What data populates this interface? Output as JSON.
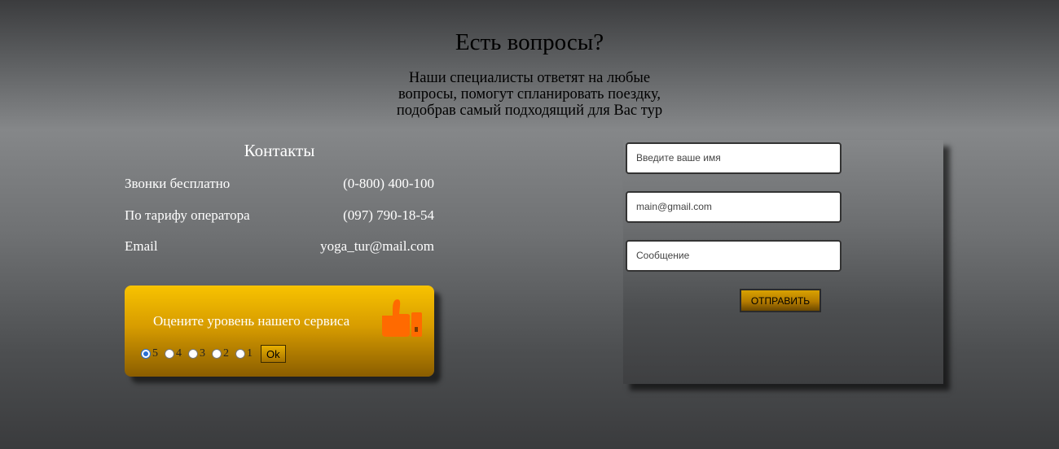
{
  "header": {
    "title": "Есть вопросы?",
    "subtitle_lines": [
      "Наши специалисты ответят на любые",
      "вопросы, помогут спланировать поездку,",
      "подобрав самый подходящий для Вас тур"
    ]
  },
  "contacts": {
    "title": "Контакты",
    "rows": [
      {
        "label": "Звонки бесплатно",
        "value": "(0-800) 400-100"
      },
      {
        "label": "По тарифу оператора",
        "value": "(097) 790-18-54"
      },
      {
        "label": "Email",
        "value": "yoga_tur@mail.com"
      }
    ]
  },
  "rating": {
    "label": "Оцените уровень нашего сервиса",
    "icon": "thumbs-up-icon",
    "options": [
      "5",
      "4",
      "3",
      "2",
      "1"
    ],
    "selected": "5",
    "ok_label": "Ok"
  },
  "form": {
    "name_placeholder": "Введите ваше имя",
    "email_placeholder": "main@gmail.com",
    "message_placeholder": "Сообщение",
    "submit_label": "ОТПРАВИТЬ"
  },
  "colors": {
    "accent": "#f8c300",
    "thumb": "#ff6a00"
  }
}
